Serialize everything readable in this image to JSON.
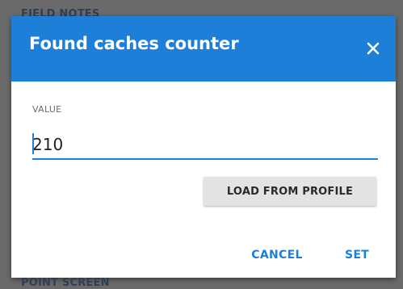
{
  "background": {
    "top_label": "FIELD NOTES",
    "bottom_label": "POINT SCREEN"
  },
  "dialog": {
    "title": "Found caches counter",
    "close_icon": "close-icon",
    "field_label": "VALUE",
    "input_value": "210",
    "load_button_label": "LOAD FROM PROFILE",
    "cancel_label": "CANCEL",
    "set_label": "SET"
  },
  "colors": {
    "accent": "#1d7fd8",
    "header_text": "#ffffff",
    "overlay": "#6a6a6a"
  }
}
